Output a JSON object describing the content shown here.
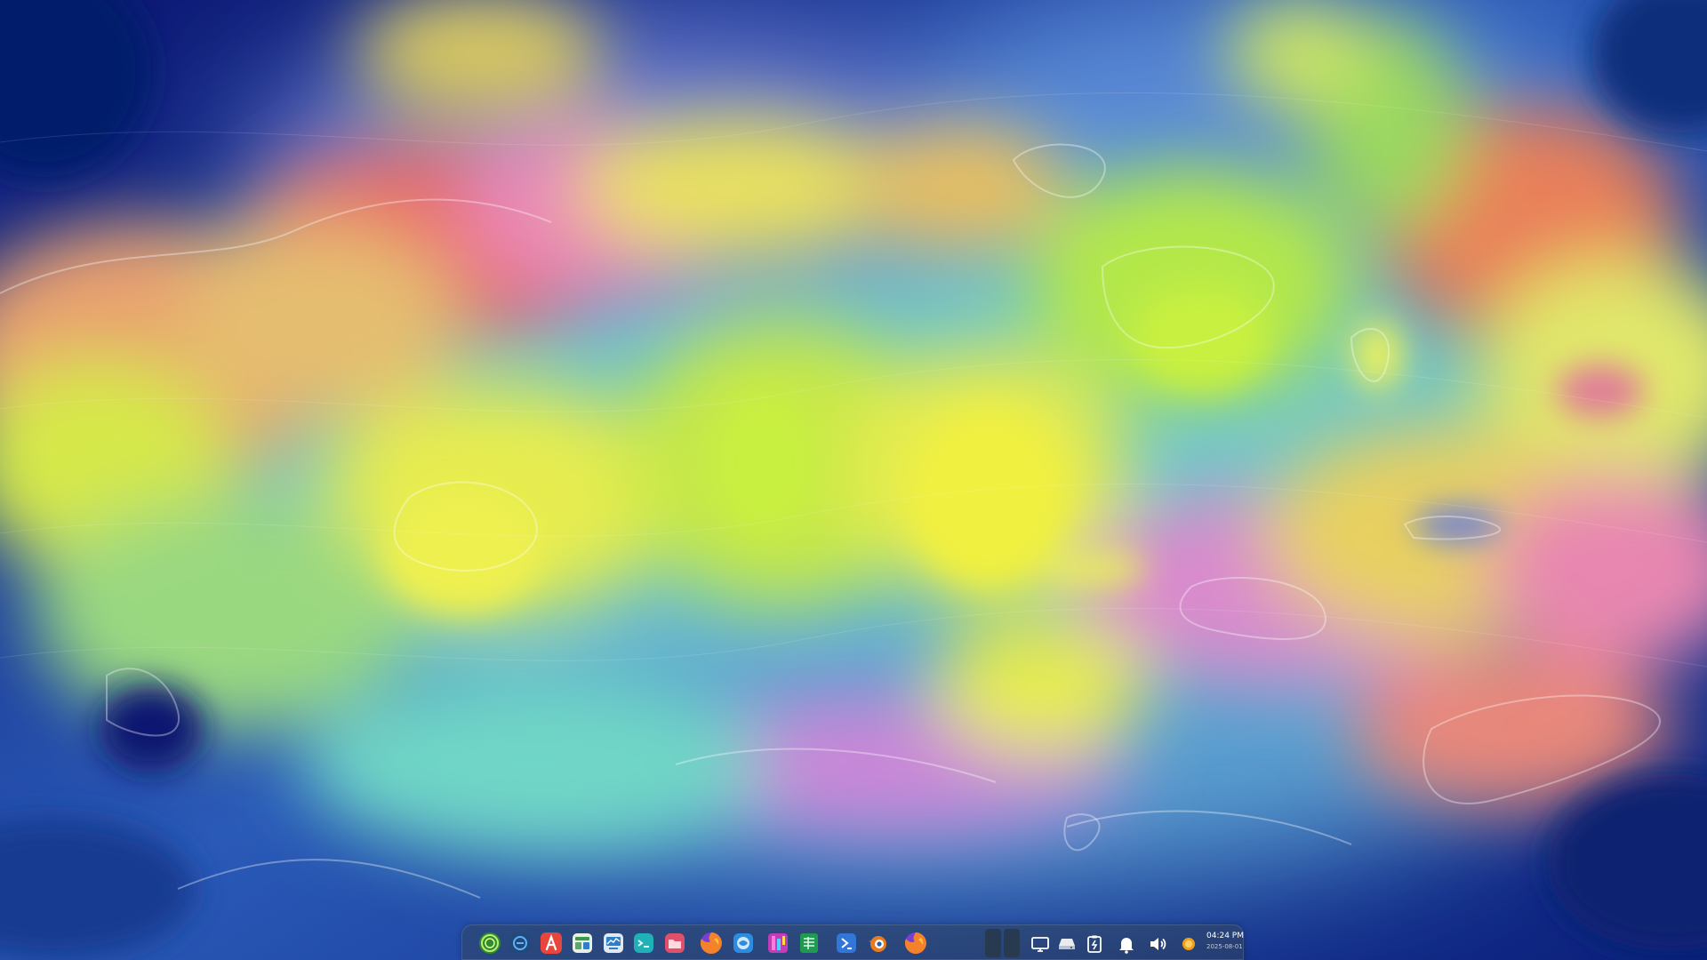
{
  "wallpaper": {
    "name": "abstract-fluid-painting",
    "colors": [
      "#0b1f7a",
      "#3e7fd0",
      "#7fd6cf",
      "#d8ec4a",
      "#e9829f",
      "#f0a040",
      "#b07fd8"
    ]
  },
  "dock": {
    "apps": [
      {
        "id": "launcher",
        "icon": "launcher-icon",
        "color": "#3a9a3a"
      },
      {
        "id": "multitask",
        "icon": "multitask-view-icon",
        "color": "#1f6fb5"
      },
      {
        "id": "app-store",
        "icon": "app-store-icon",
        "color": "#e8453c"
      },
      {
        "id": "control-center",
        "icon": "control-center-icon",
        "color": "#5aa86a"
      },
      {
        "id": "system-monitor",
        "icon": "system-monitor-icon",
        "color": "#2f7fc8"
      },
      {
        "id": "terminal",
        "icon": "terminal-icon",
        "color": "#1fb0b8"
      },
      {
        "id": "file-manager",
        "icon": "folder-icon",
        "color": "#e0506a"
      },
      {
        "id": "firefox",
        "icon": "firefox-icon",
        "color": "#e8742a"
      },
      {
        "id": "browser",
        "icon": "browser-icon",
        "color": "#2e8ce0"
      },
      {
        "id": "graphics-editor",
        "icon": "graphics-editor-icon",
        "color": "#c03cb8"
      },
      {
        "id": "spreadsheet",
        "icon": "spreadsheet-icon",
        "color": "#1f9a50"
      },
      {
        "id": "code-editor",
        "icon": "code-editor-icon",
        "color": "#3277d8"
      },
      {
        "id": "blender",
        "icon": "blender-icon",
        "color": "#e87a1f"
      },
      {
        "id": "firefox-2",
        "icon": "firefox-icon",
        "color": "#e8742a"
      }
    ],
    "tray": [
      {
        "id": "show-desktop",
        "icon": "monitor-icon"
      },
      {
        "id": "storage",
        "icon": "drive-icon"
      },
      {
        "id": "clipboard",
        "icon": "clipboard-icon"
      },
      {
        "id": "notifications",
        "icon": "bell-icon"
      },
      {
        "id": "volume",
        "icon": "volume-icon"
      },
      {
        "id": "weather",
        "icon": "weather-icon"
      }
    ],
    "clock": {
      "time": "04:24 PM",
      "date": "2025-08-01"
    }
  }
}
